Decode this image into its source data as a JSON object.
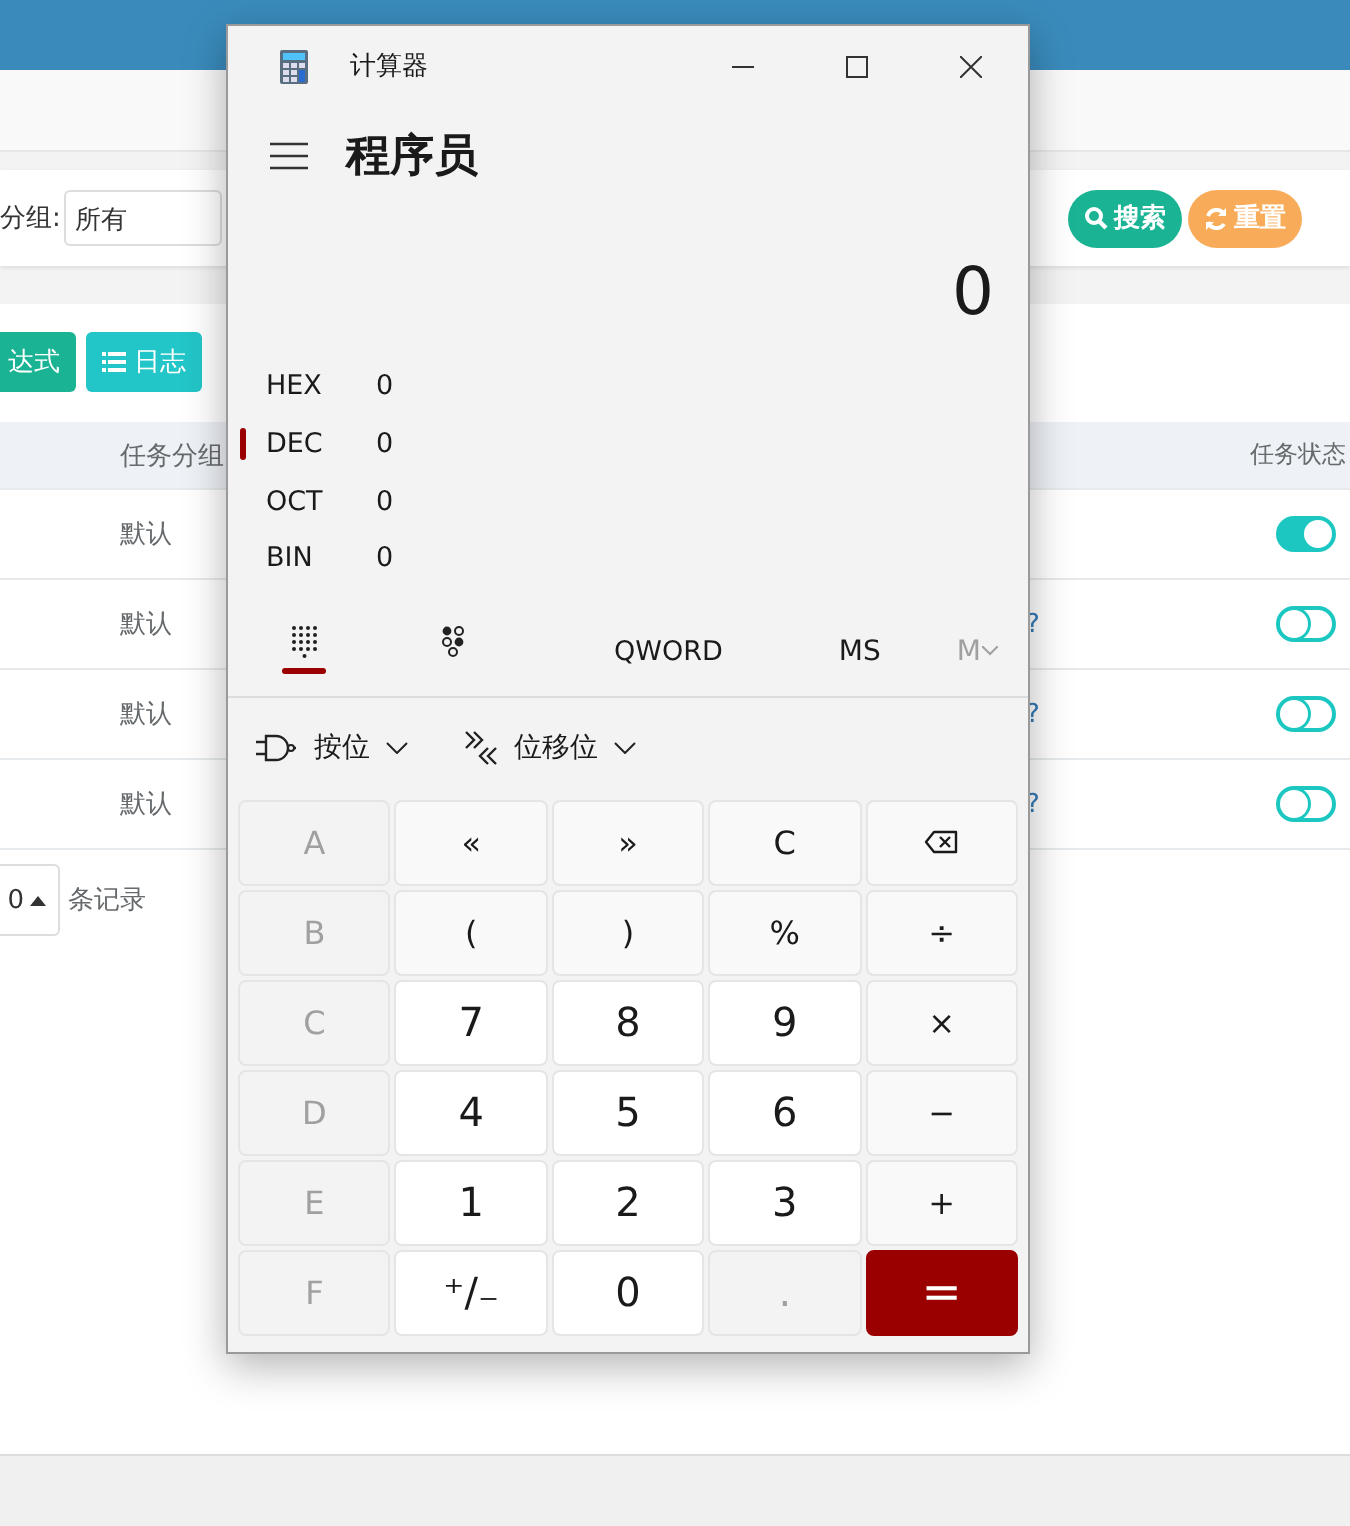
{
  "background_page": {
    "filter": {
      "label": "分组:",
      "value": "所有"
    },
    "search_buttons": [
      {
        "kind": "search",
        "label": "搜索"
      },
      {
        "kind": "reset",
        "label": "重置"
      }
    ],
    "toolbar": [
      {
        "kind": "expression",
        "label": "达式"
      },
      {
        "kind": "log",
        "label": "日志"
      }
    ],
    "table": {
      "columns": [
        "任务分组",
        "任务状态"
      ],
      "rows": [
        {
          "group": "默认",
          "on": true
        },
        {
          "group": "默认",
          "column_3": "?",
          "on": false
        },
        {
          "group": "默认",
          "column_3": "?",
          "on": false
        },
        {
          "group": "默认",
          "column_3": "?",
          "on": false
        }
      ]
    },
    "pagination": {
      "page_size": "0",
      "suffix": "条记录"
    }
  },
  "calculator": {
    "title": "计算器",
    "mode": "程序员",
    "display": "0",
    "radixes": [
      {
        "label": "HEX",
        "value": "0",
        "selected": false
      },
      {
        "label": "DEC",
        "value": "0",
        "selected": true
      },
      {
        "label": "OCT",
        "value": "0",
        "selected": false
      },
      {
        "label": "BIN",
        "value": "0",
        "selected": false
      }
    ],
    "tabs": [
      {
        "kind": "keypad",
        "selected": true
      },
      {
        "kind": "bits",
        "selected": false
      }
    ],
    "word_size": "QWORD",
    "memory_buttons": [
      {
        "label": "MS",
        "disabled": false
      },
      {
        "label": "M",
        "disabled": true
      }
    ],
    "menus": [
      {
        "kind": "bitwise",
        "label": "按位"
      },
      {
        "kind": "shift",
        "label": "位移位"
      }
    ],
    "keys": [
      {
        "kind": "hex",
        "label": "A",
        "disabled": true
      },
      {
        "kind": "operator",
        "label": "«",
        "disabled": false
      },
      {
        "kind": "operator",
        "label": "»",
        "disabled": false
      },
      {
        "kind": "operator",
        "label": "C",
        "disabled": false
      },
      {
        "kind": "backspace",
        "disabled": false
      },
      {
        "kind": "hex",
        "label": "B",
        "disabled": true
      },
      {
        "kind": "operator",
        "label": "(",
        "disabled": false
      },
      {
        "kind": "operator",
        "label": ")",
        "disabled": false
      },
      {
        "kind": "operator",
        "label": "%",
        "disabled": false
      },
      {
        "kind": "operator",
        "label": "÷",
        "disabled": false
      },
      {
        "kind": "hex",
        "label": "C",
        "disabled": true
      },
      {
        "kind": "digit",
        "label": "7",
        "disabled": false
      },
      {
        "kind": "digit",
        "label": "8",
        "disabled": false
      },
      {
        "kind": "digit",
        "label": "9",
        "disabled": false
      },
      {
        "kind": "operator",
        "label": "×",
        "disabled": false
      },
      {
        "kind": "hex",
        "label": "D",
        "disabled": true
      },
      {
        "kind": "digit",
        "label": "4",
        "disabled": false
      },
      {
        "kind": "digit",
        "label": "5",
        "disabled": false
      },
      {
        "kind": "digit",
        "label": "6",
        "disabled": false
      },
      {
        "kind": "operator",
        "label": "−",
        "disabled": false
      },
      {
        "kind": "hex",
        "label": "E",
        "disabled": true
      },
      {
        "kind": "digit",
        "label": "1",
        "disabled": false
      },
      {
        "kind": "digit",
        "label": "2",
        "disabled": false
      },
      {
        "kind": "digit",
        "label": "3",
        "disabled": false
      },
      {
        "kind": "operator",
        "label": "+",
        "disabled": false
      },
      {
        "kind": "hex",
        "label": "F",
        "disabled": true
      },
      {
        "kind": "digit",
        "label": "⁺/₋",
        "disabled": false
      },
      {
        "kind": "digit",
        "label": "0",
        "disabled": false
      },
      {
        "kind": "digit",
        "label": ".",
        "disabled": true
      },
      {
        "kind": "equals",
        "label": "=",
        "disabled": false
      }
    ]
  }
}
